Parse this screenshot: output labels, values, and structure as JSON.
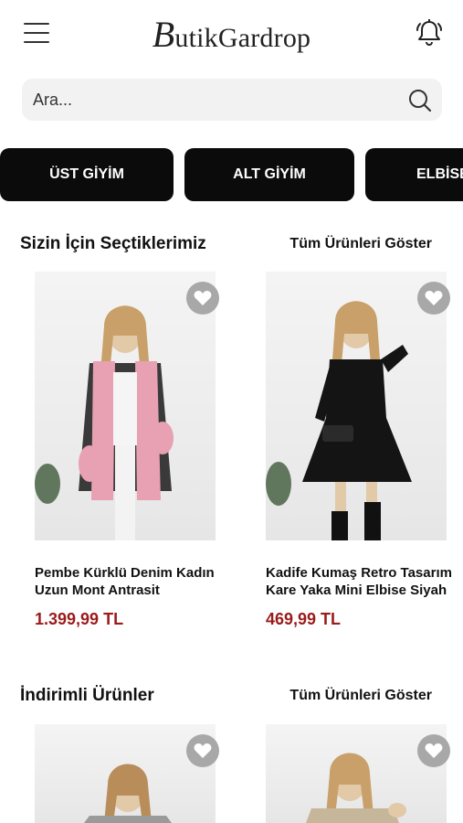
{
  "header": {
    "logo_initial": "B",
    "logo_rest": "utikGardrop"
  },
  "search": {
    "placeholder": "Ara..."
  },
  "categories": [
    {
      "label": "ÜST GİYİM"
    },
    {
      "label": "ALT GİYİM"
    },
    {
      "label": "ELBİSE"
    }
  ],
  "sections": [
    {
      "title": "Sizin İçin Seçtiklerimiz",
      "show_all": "Tüm Ürünleri Göster",
      "products": [
        {
          "name_line1": "Pembe Kürklü Denim Kadın",
          "name_line2": "Uzun Mont Antrasit",
          "price": "1.399,99 TL"
        },
        {
          "name_line1": "Kadife Kumaş Retro Tasarım",
          "name_line2": "Kare Yaka Mini Elbise Siyah",
          "price": "469,99 TL"
        }
      ]
    },
    {
      "title": "İndirimli Ürünler",
      "show_all": "Tüm Ürünleri Göster",
      "products": [
        {
          "name_line1": "",
          "name_line2": "",
          "price": ""
        },
        {
          "name_line1": "",
          "name_line2": "",
          "price": ""
        }
      ]
    }
  ],
  "colors": {
    "price": "#9b1b1b",
    "category_bg": "#0b0b0b",
    "favorite_bg": "#a8a8a8"
  }
}
